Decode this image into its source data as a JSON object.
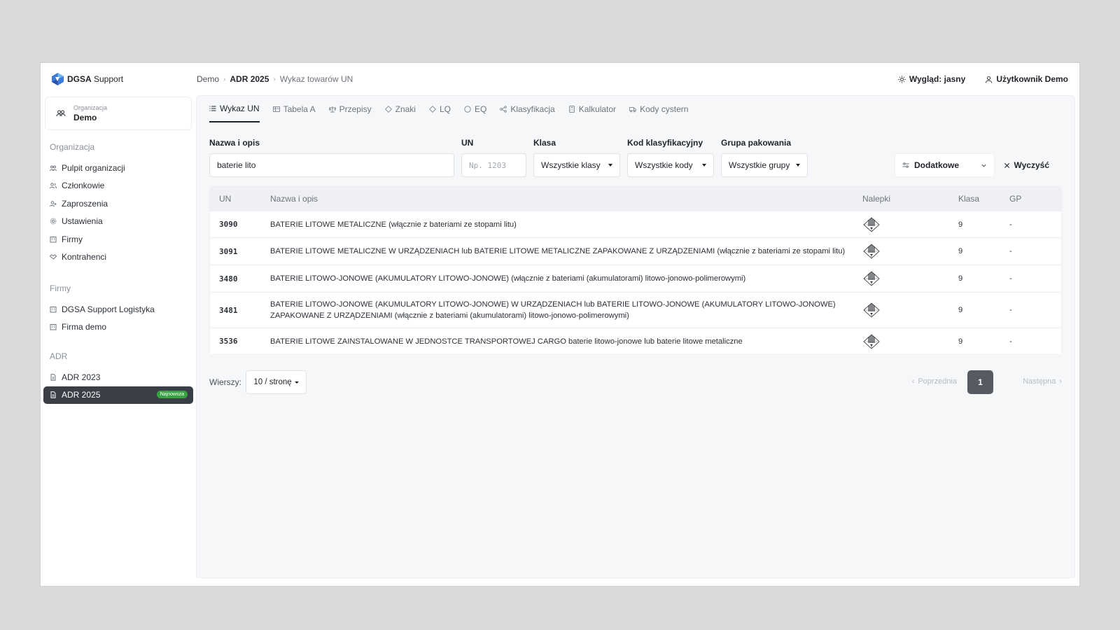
{
  "brand": {
    "strong": "DGSA",
    "rest": " Support"
  },
  "org": {
    "caption": "Organizacja",
    "name": "Demo"
  },
  "sidebar": {
    "sections": [
      {
        "title": "Organizacja",
        "items": [
          "Pulpit organizacji",
          "Członkowie",
          "Zaproszenia",
          "Ustawienia",
          "Firmy",
          "Kontrahenci"
        ]
      },
      {
        "title": "Firmy",
        "items": [
          "DGSA Support Logistyka",
          "Firma demo"
        ]
      },
      {
        "title": "ADR",
        "items": [
          "ADR 2023",
          "ADR 2025"
        ],
        "active_badge": "Najnowsza"
      }
    ]
  },
  "breadcrumb": [
    "Demo",
    "ADR 2025",
    "Wykaz towarów UN"
  ],
  "top_actions": {
    "theme": "Wygląd: jasny",
    "user": "Użytkownik Demo"
  },
  "tabs": [
    "Wykaz UN",
    "Tabela A",
    "Przepisy",
    "Znaki",
    "LQ",
    "EQ",
    "Klasyfikacja",
    "Kalkulator",
    "Kody cystern"
  ],
  "filters": {
    "name": {
      "label": "Nazwa i opis",
      "value": "baterie lito"
    },
    "un": {
      "label": "UN",
      "placeholder": "Np. 1203"
    },
    "class": {
      "label": "Klasa",
      "value": "Wszystkie klasy"
    },
    "code": {
      "label": "Kod klasyfikacyjny",
      "value": "Wszystkie kody"
    },
    "group": {
      "label": "Grupa pakowania",
      "value": "Wszystkie grupy"
    },
    "extra": "Dodatkowe",
    "clear": "Wyczyść"
  },
  "table": {
    "headers": [
      "UN",
      "Nazwa i opis",
      "Nalepki",
      "Klasa",
      "GP"
    ],
    "rows": [
      {
        "un": "3090",
        "name": "BATERIE LITOWE METALICZNE (włącznie z bateriami ze stopami litu)",
        "cls": "9",
        "gp": "-"
      },
      {
        "un": "3091",
        "name": "BATERIE LITOWE METALICZNE W URZĄDZENIACH lub BATERIE LITOWE METALICZNE ZAPAKOWANE Z URZĄDZENIAMI (włącznie z bateriami ze stopami litu)",
        "cls": "9",
        "gp": "-"
      },
      {
        "un": "3480",
        "name": "BATERIE LITOWO-JONOWE (AKUMULATORY LITOWO-JONOWE) (włącznie z bateriami (akumulatorami) litowo-jonowo-polimerowymi)",
        "cls": "9",
        "gp": "-"
      },
      {
        "un": "3481",
        "name": "BATERIE LITOWO-JONOWE (AKUMULATORY LITOWO-JONOWE) W URZĄDZENIACH lub BATERIE LITOWO-JONOWE (AKUMULATORY LITOWO-JONOWE) ZAPAKOWANE Z URZĄDZENIAMI (włącznie z bateriami (akumulatorami) litowo-jonowo-polimerowymi)",
        "cls": "9",
        "gp": "-"
      },
      {
        "un": "3536",
        "name": "BATERIE LITOWE ZAINSTALOWANE W JEDNOSTCE TRANSPORTOWEJ CARGO baterie litowo-jonowe lub baterie litowe metaliczne",
        "cls": "9",
        "gp": "-"
      }
    ]
  },
  "pagination": {
    "rows_label": "Wierszy:",
    "per_page": "10 / stronę",
    "prev": "Poprzednia",
    "current": "1",
    "next": "Następna"
  },
  "colors": {
    "active_nav": "#3a3f47",
    "badge": "#36a540",
    "page_current": "#565b63"
  }
}
